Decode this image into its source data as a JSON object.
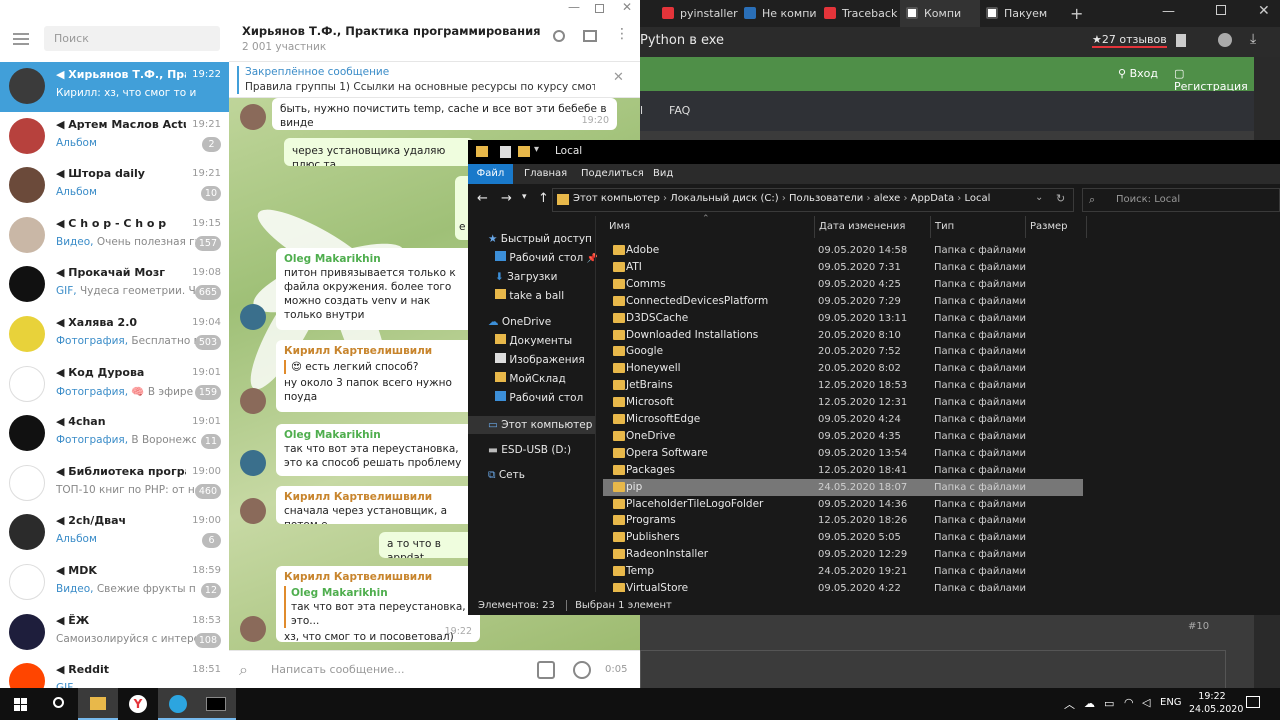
{
  "browser": {
    "tabs": [
      {
        "label": "pyinstaller",
        "color": "#e4343a"
      },
      {
        "label": "Не компи",
        "color": "#2a6fb8"
      },
      {
        "label": "Traceback",
        "color": "#e4343a"
      },
      {
        "label": "Компи",
        "color": "#555555"
      },
      {
        "label": "Пакуем",
        "color": "#555555"
      }
    ],
    "page_title": "Python в exe",
    "reviews": "★27 отзывов",
    "login": "Вход",
    "register": "Регистрация",
    "faq": "FAQ",
    "post_num": "#10"
  },
  "telegram": {
    "search_placeholder": "Поиск",
    "group_title": "Хирьянов Т.Ф., Практика программирования на ...",
    "members": "2 001 участник",
    "pinned_title": "Закреплённое сообщение",
    "pinned_text": "Правила группы 1) Ссылки на основные ресурсы по курсу смотреть...",
    "input_placeholder": "Написать сообщение...",
    "timer": "0:05",
    "chats": [
      {
        "name": "Хирьянов Т.Ф., Прак...",
        "time": "19:22",
        "prefix": "",
        "preview": "Кирилл: хз, что смог то и посов...",
        "badge": "",
        "color": "#3b3b3b"
      },
      {
        "name": "Артем Маслов Actual",
        "time": "19:21",
        "prefix": "Альбом",
        "preview": "",
        "badge": "2",
        "color": "#b7413d"
      },
      {
        "name": "Штора daily",
        "time": "19:21",
        "prefix": "Альбом",
        "preview": "",
        "badge": "10",
        "color": "#6b4a3a"
      },
      {
        "name": "C h o p - C h o p",
        "time": "19:15",
        "prefix": "Видео,",
        "preview": " Очень полезная гр...",
        "badge": "157",
        "color": "#c9b7a6"
      },
      {
        "name": "Прокачай Мозг",
        "time": "19:08",
        "prefix": "GIF,",
        "preview": " Чудеса геометрии. Че...",
        "badge": "665",
        "color": "#111111"
      },
      {
        "name": "Халява 2.0",
        "time": "19:04",
        "prefix": "Фотография,",
        "preview": " Бесплатно п...",
        "badge": "503",
        "color": "#e8d23a"
      },
      {
        "name": "Код Дурова",
        "time": "19:01",
        "prefix": "Фотография,",
        "preview": " 🧠 В эфире ...",
        "badge": "159",
        "color": "#ffffff"
      },
      {
        "name": "4chan",
        "time": "19:01",
        "prefix": "Фотография,",
        "preview": " В Воронежск...",
        "badge": "11",
        "color": "#111111"
      },
      {
        "name": "Библиотека програм...",
        "time": "19:00",
        "prefix": "",
        "preview": "ТОП-10 книг по PHP: от но...",
        "badge": "460",
        "color": "#ffffff"
      },
      {
        "name": "2ch/Двач",
        "time": "19:00",
        "prefix": "Альбом",
        "preview": "",
        "badge": "6",
        "color": "#2b2b2b"
      },
      {
        "name": "MDK",
        "time": "18:59",
        "prefix": "Видео,",
        "preview": " Свежие фрукты по с...",
        "badge": "12",
        "color": "#ffffff"
      },
      {
        "name": "ЁЖ",
        "time": "18:53",
        "prefix": "",
        "preview": "Самоизолируйся с интере...",
        "badge": "108",
        "color": "#1e1e3c"
      },
      {
        "name": "Reddit",
        "time": "18:51",
        "prefix": "GIF,",
        "preview": "",
        "badge": "",
        "color": "#ff4500"
      }
    ],
    "messages": [
      {
        "author": "",
        "text": "быть, нужно почистить temp, cache и все вот эти бебебе в винде",
        "time": "19:20"
      },
      {
        "author": "",
        "text": "через установщика удаляю плюс та"
      },
      {
        "author": "Oleg Makarikhin",
        "text": "питон привязывается только к файла окружения. более того можно создать venv и нак только внутри"
      },
      {
        "author": "Кирилл Картвелишвили",
        "reply": "😍 есть легкий способ?",
        "text": "ну около 3 папок всего нужно поуда"
      },
      {
        "author": "Oleg Makarikhin",
        "text": "так что вот эта переустановка, это ка способ решать проблему"
      },
      {
        "author": "Кирилл Картвелишвили",
        "text": "сначала через установщик, а потом е"
      },
      {
        "author": "",
        "text": "а то что в appdat"
      },
      {
        "author": "Кирилл Картвелишвили",
        "reply_author": "Oleg Makarikhin",
        "reply": "так что вот эта переустановка, это...",
        "text": "хз, что смог то и посоветовал)",
        "time": "19:22"
      }
    ],
    "partial_out_letter": "е"
  },
  "explorer": {
    "title": "Local",
    "ribbon": [
      "Файл",
      "Главная",
      "Поделиться",
      "Вид"
    ],
    "path": [
      "Этот компьютер",
      "Локальный диск (C:)",
      "Пользователи",
      "alexe",
      "AppData",
      "Local"
    ],
    "search_placeholder": "Поиск: Local",
    "columns": [
      "Имя",
      "Дата изменения",
      "Тип",
      "Размер"
    ],
    "sidebar": [
      {
        "label": "Быстрый доступ",
        "icon": "star-icon"
      },
      {
        "label": "Рабочий стол",
        "icon": "folder-icon"
      },
      {
        "label": "Загрузки",
        "icon": "download-icon"
      },
      {
        "label": "take a ball",
        "icon": "folder-icon"
      },
      {
        "label": "OneDrive",
        "icon": "cloud-icon"
      },
      {
        "label": "Документы",
        "icon": "folder-icon"
      },
      {
        "label": "Изображения",
        "icon": "folder-icon"
      },
      {
        "label": "МойСклад",
        "icon": "folder-icon"
      },
      {
        "label": "Рабочий стол",
        "icon": "folder-icon"
      },
      {
        "label": "Этот компьютер",
        "icon": "pc-icon"
      },
      {
        "label": "ESD-USB (D:)",
        "icon": "drive-icon"
      },
      {
        "label": "Сеть",
        "icon": "network-icon"
      }
    ],
    "files": [
      {
        "name": "Adobe",
        "date": "09.05.2020 14:58",
        "type": "Папка с файлами"
      },
      {
        "name": "ATI",
        "date": "09.05.2020 7:31",
        "type": "Папка с файлами"
      },
      {
        "name": "Comms",
        "date": "09.05.2020 4:25",
        "type": "Папка с файлами"
      },
      {
        "name": "ConnectedDevicesPlatform",
        "date": "09.05.2020 7:29",
        "type": "Папка с файлами"
      },
      {
        "name": "D3DSCache",
        "date": "09.05.2020 13:11",
        "type": "Папка с файлами"
      },
      {
        "name": "Downloaded Installations",
        "date": "20.05.2020 8:10",
        "type": "Папка с файлами"
      },
      {
        "name": "Google",
        "date": "20.05.2020 7:52",
        "type": "Папка с файлами"
      },
      {
        "name": "Honeywell",
        "date": "20.05.2020 8:02",
        "type": "Папка с файлами"
      },
      {
        "name": "JetBrains",
        "date": "12.05.2020 18:53",
        "type": "Папка с файлами"
      },
      {
        "name": "Microsoft",
        "date": "12.05.2020 12:31",
        "type": "Папка с файлами"
      },
      {
        "name": "MicrosoftEdge",
        "date": "09.05.2020 4:24",
        "type": "Папка с файлами"
      },
      {
        "name": "OneDrive",
        "date": "09.05.2020 4:35",
        "type": "Папка с файлами"
      },
      {
        "name": "Opera Software",
        "date": "09.05.2020 13:54",
        "type": "Папка с файлами"
      },
      {
        "name": "Packages",
        "date": "12.05.2020 18:41",
        "type": "Папка с файлами"
      },
      {
        "name": "pip",
        "date": "24.05.2020 18:07",
        "type": "Папка с файлами"
      },
      {
        "name": "PlaceholderTileLogoFolder",
        "date": "09.05.2020 14:36",
        "type": "Папка с файлами"
      },
      {
        "name": "Programs",
        "date": "12.05.2020 18:26",
        "type": "Папка с файлами"
      },
      {
        "name": "Publishers",
        "date": "09.05.2020 5:05",
        "type": "Папка с файлами"
      },
      {
        "name": "RadeonInstaller",
        "date": "09.05.2020 12:29",
        "type": "Папка с файлами"
      },
      {
        "name": "Temp",
        "date": "24.05.2020 19:21",
        "type": "Папка с файлами"
      },
      {
        "name": "VirtualStore",
        "date": "09.05.2020 4:22",
        "type": "Папка с файлами"
      }
    ],
    "selected_index": 14,
    "status_count": "Элементов: 23",
    "status_selected": "Выбран 1 элемент"
  },
  "taskbar": {
    "lang": "ENG",
    "time": "19:22",
    "date": "24.05.2020"
  }
}
